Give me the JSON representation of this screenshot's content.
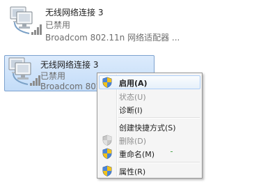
{
  "connections": [
    {
      "title": "无线网络连接 3",
      "status": "已禁用",
      "device": "Broadcom 802.11n 网络适配器 ..."
    },
    {
      "title": "无线网络连接 3",
      "status": "已禁用",
      "device": "Broadcom 802.11n 网络适配器"
    }
  ],
  "context_menu": {
    "items": [
      {
        "label": "启用(A)",
        "icon": "shield-icon"
      },
      {
        "label": "状态(U)"
      },
      {
        "label": "诊断(I)"
      },
      {
        "label": "创建快捷方式(S)"
      },
      {
        "label": "删除(D)",
        "icon": "shield-icon"
      },
      {
        "label": "重命名(M)",
        "icon": "shield-icon"
      },
      {
        "label": "属性(R)",
        "icon": "shield-icon"
      }
    ]
  },
  "colors": {
    "selection_bg": "#cde1f9",
    "selection_border": "#7da2ce",
    "menu_bg": "#f5f5f5",
    "disabled_text": "#8d8d8d",
    "shield_blue": "#2e64b7",
    "shield_yellow": "#f2c21a"
  }
}
